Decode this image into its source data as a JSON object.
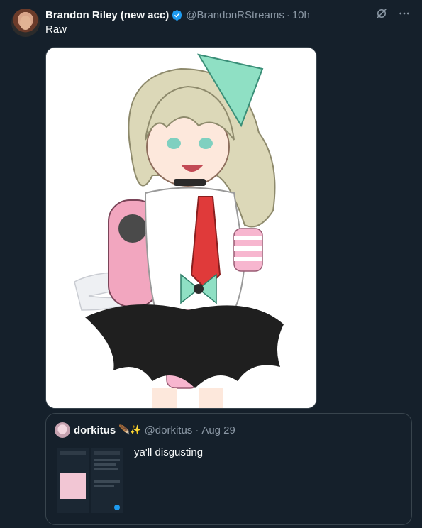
{
  "tweet": {
    "display_name": "Brandon Riley (new acc)",
    "handle": "@BrandonRStreams",
    "separator": "·",
    "time": "10h",
    "text": "Raw",
    "verified_icon": "verified-badge-icon",
    "actions": [
      "grok-icon",
      "more-icon"
    ],
    "media_description_icon": "anime-girl-illustration"
  },
  "quote": {
    "display_name": "dorkitus",
    "emoji": "🪶✨",
    "handle": "@dorkitus",
    "separator": "·",
    "time": "Aug 29",
    "text": "ya'll disgusting"
  },
  "colors": {
    "background": "#15202b",
    "border": "#38444d",
    "muted": "#8b98a5",
    "text": "#f7f9f9",
    "verified": "#1d9bf0"
  }
}
